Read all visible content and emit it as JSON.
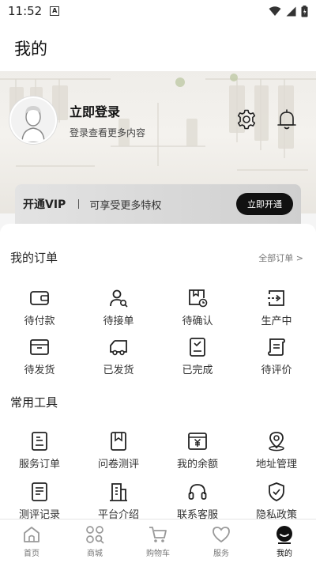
{
  "status_bar": {
    "time": "11:52",
    "notification_badge": "A"
  },
  "header": {
    "title": "我的"
  },
  "profile": {
    "login_title": "立即登录",
    "login_subtitle": "登录查看更多内容",
    "settings_icon": "gear-icon",
    "notification_icon": "bell-icon"
  },
  "vip": {
    "title": "开通VIP",
    "description": "可享受更多特权",
    "button_label": "立即开通"
  },
  "orders": {
    "title": "我的订单",
    "all_link": "全部订单 >",
    "items": [
      {
        "label": "待付款",
        "icon": "wallet-icon"
      },
      {
        "label": "待接单",
        "icon": "user-search-icon"
      },
      {
        "label": "待确认",
        "icon": "clock-box-icon"
      },
      {
        "label": "生产中",
        "icon": "arrow-box-icon"
      },
      {
        "label": "待发货",
        "icon": "box-icon"
      },
      {
        "label": "已发货",
        "icon": "truck-icon"
      },
      {
        "label": "已完成",
        "icon": "check-doc-icon"
      },
      {
        "label": "待评价",
        "icon": "scroll-icon"
      }
    ]
  },
  "tools": {
    "title": "常用工具",
    "items": [
      {
        "label": "服务订单",
        "icon": "document-icon"
      },
      {
        "label": "问卷测评",
        "icon": "bookmark-icon"
      },
      {
        "label": "我的余额",
        "icon": "yuan-box-icon"
      },
      {
        "label": "地址管理",
        "icon": "location-icon"
      },
      {
        "label": "测评记录",
        "icon": "records-icon"
      },
      {
        "label": "平台介绍",
        "icon": "building-icon"
      },
      {
        "label": "联系客服",
        "icon": "headset-icon"
      },
      {
        "label": "隐私政策",
        "icon": "shield-icon"
      }
    ]
  },
  "tabbar": {
    "items": [
      {
        "label": "首页",
        "icon": "home-icon",
        "active": false
      },
      {
        "label": "商城",
        "icon": "grid-search-icon",
        "active": false
      },
      {
        "label": "购物车",
        "icon": "cart-icon",
        "active": false
      },
      {
        "label": "服务",
        "icon": "heart-icon",
        "active": false
      },
      {
        "label": "我的",
        "icon": "profile-icon",
        "active": true
      }
    ]
  }
}
